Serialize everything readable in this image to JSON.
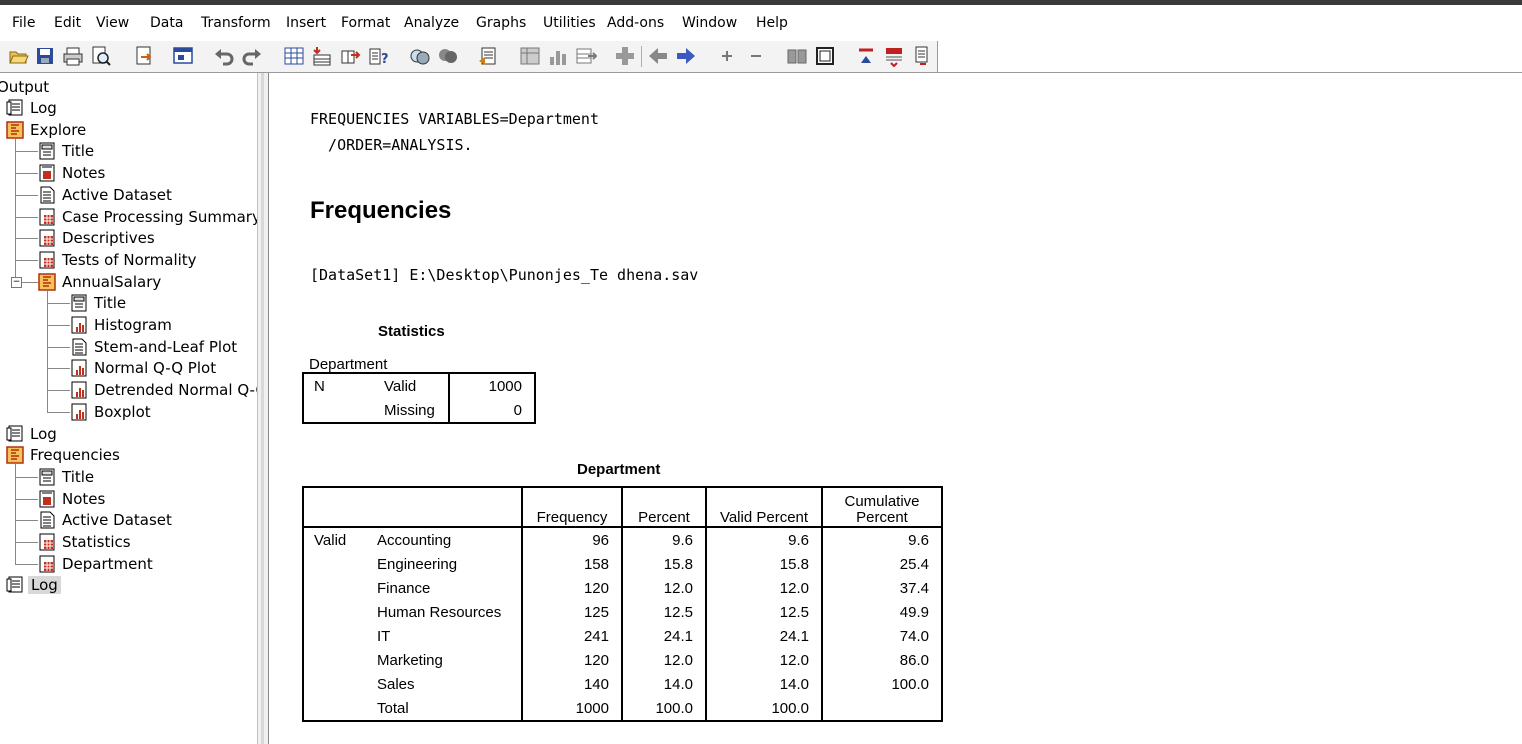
{
  "menu": [
    "File",
    "Edit",
    "View",
    "Data",
    "Transform",
    "Insert",
    "Format",
    "Analyze",
    "Graphs",
    "Utilities",
    "Add-ons",
    "Window",
    "Help"
  ],
  "toolbar_icons": [
    "open-icon",
    "save-icon",
    "print-icon",
    "print-preview-icon",
    "export-icon",
    "recall-dialog-icon",
    "undo-icon",
    "redo-icon",
    "goto-data-icon",
    "goto-case-icon",
    "goto-variable-icon",
    "variables-icon",
    "use-sets-icon",
    "show-all-variables-icon",
    "designate-window-icon",
    "pivot-icon",
    "chart-builder-icon",
    "select-cases-icon",
    "script-icon",
    "insert-icon",
    "back-icon",
    "forward-icon",
    "expand-icon",
    "collapse-icon",
    "show-icon",
    "hide-icon",
    "promote-icon",
    "demote-icon",
    "insert-heading-icon"
  ],
  "outline": {
    "root": "Output",
    "nodes": [
      {
        "label": "Log",
        "icon": "log-icon"
      },
      {
        "label": "Explore",
        "icon": "procedure-icon"
      },
      {
        "label": "Title",
        "icon": "title-icon"
      },
      {
        "label": "Notes",
        "icon": "notes-icon"
      },
      {
        "label": "Active Dataset",
        "icon": "text-doc-icon"
      },
      {
        "label": "Case Processing Summary",
        "icon": "table-icon"
      },
      {
        "label": "Descriptives",
        "icon": "table-icon"
      },
      {
        "label": "Tests of Normality",
        "icon": "table-icon"
      },
      {
        "label": "AnnualSalary",
        "icon": "procedure-icon"
      },
      {
        "label": "Title",
        "icon": "title-icon"
      },
      {
        "label": "Histogram",
        "icon": "chart-icon"
      },
      {
        "label": "Stem-and-Leaf Plot",
        "icon": "text-doc-icon"
      },
      {
        "label": "Normal Q-Q Plot",
        "icon": "chart-icon"
      },
      {
        "label": "Detrended Normal Q-Q",
        "icon": "chart-icon"
      },
      {
        "label": "Boxplot",
        "icon": "chart-icon"
      },
      {
        "label": "Log",
        "icon": "log-icon"
      },
      {
        "label": "Frequencies",
        "icon": "procedure-icon"
      },
      {
        "label": "Title",
        "icon": "title-icon"
      },
      {
        "label": "Notes",
        "icon": "notes-icon"
      },
      {
        "label": "Active Dataset",
        "icon": "text-doc-icon"
      },
      {
        "label": "Statistics",
        "icon": "table-icon"
      },
      {
        "label": "Department",
        "icon": "table-icon"
      },
      {
        "label": "Log",
        "icon": "log-icon"
      }
    ]
  },
  "content": {
    "syntax_line1": "FREQUENCIES VARIABLES=Department",
    "syntax_line2": "  /ORDER=ANALYSIS.",
    "heading": "Frequencies",
    "dataset_line": "[DataSet1] E:\\Desktop\\Punonjes_Te dhena.sav",
    "statistics": {
      "title": "Statistics",
      "var_label": "Department",
      "row_label": "N",
      "valid_label": "Valid",
      "valid_value": "1000",
      "missing_label": "Missing",
      "missing_value": "0"
    },
    "department_table": {
      "title": "Department",
      "headers": [
        "Frequency",
        "Percent",
        "Valid Percent",
        "Cumulative Percent"
      ],
      "header_cum_line1": "Cumulative",
      "header_cum_line2": "Percent",
      "group_label": "Valid",
      "rows": [
        {
          "label": "Accounting",
          "freq": "96",
          "pct": "9.6",
          "valid": "9.6",
          "cum": "9.6"
        },
        {
          "label": "Engineering",
          "freq": "158",
          "pct": "15.8",
          "valid": "15.8",
          "cum": "25.4"
        },
        {
          "label": "Finance",
          "freq": "120",
          "pct": "12.0",
          "valid": "12.0",
          "cum": "37.4"
        },
        {
          "label": "Human Resources",
          "freq": "125",
          "pct": "12.5",
          "valid": "12.5",
          "cum": "49.9"
        },
        {
          "label": "IT",
          "freq": "241",
          "pct": "24.1",
          "valid": "24.1",
          "cum": "74.0"
        },
        {
          "label": "Marketing",
          "freq": "120",
          "pct": "12.0",
          "valid": "12.0",
          "cum": "86.0"
        },
        {
          "label": "Sales",
          "freq": "140",
          "pct": "14.0",
          "valid": "14.0",
          "cum": "100.0"
        },
        {
          "label": "Total",
          "freq": "1000",
          "pct": "100.0",
          "valid": "100.0",
          "cum": ""
        }
      ]
    }
  }
}
